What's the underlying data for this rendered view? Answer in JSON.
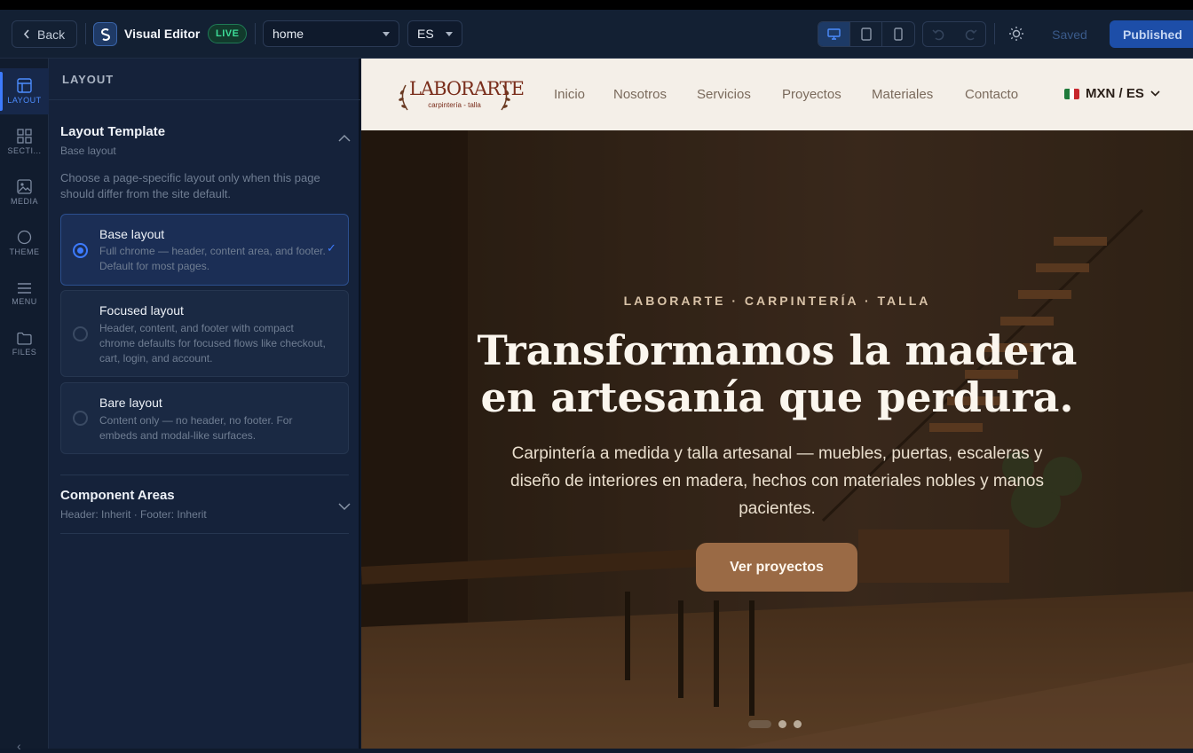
{
  "toolbar": {
    "back_label": "Back",
    "app_title": "Visual Editor",
    "status_badge": "LIVE",
    "page_select": "home",
    "lang_select": "ES",
    "saved_label": "Saved",
    "published_label": "Published",
    "devices": [
      "desktop-icon",
      "tablet-icon",
      "mobile-icon"
    ],
    "active_device": "desktop"
  },
  "rail": {
    "items": [
      {
        "label": "LAYOUT",
        "icon": "layout-icon",
        "active": true
      },
      {
        "label": "SECTI...",
        "icon": "sections-icon"
      },
      {
        "label": "MEDIA",
        "icon": "media-icon"
      },
      {
        "label": "THEME",
        "icon": "theme-icon"
      },
      {
        "label": "MENU",
        "icon": "menu-icon"
      },
      {
        "label": "FILES",
        "icon": "files-icon"
      }
    ]
  },
  "panel": {
    "heading": "LAYOUT",
    "layout_template": {
      "title": "Layout Template",
      "subtitle": "Base layout",
      "hint": "Choose a page-specific layout only when this page should differ from the site default.",
      "options": [
        {
          "title": "Base layout",
          "desc": "Full chrome — header, content area, and footer. Default for most pages.",
          "selected": true
        },
        {
          "title": "Focused layout",
          "desc": "Header, content, and footer with compact chrome defaults for focused flows like checkout, cart, login, and account."
        },
        {
          "title": "Bare layout",
          "desc": "Content only — no header, no footer. For embeds and modal-like surfaces."
        }
      ]
    },
    "component_areas": {
      "title": "Component Areas",
      "subtitle": "Header: Inherit · Footer: Inherit"
    }
  },
  "site": {
    "brand": {
      "name": "LABORARTE",
      "tagline": "carpintería - talla"
    },
    "nav": [
      "Inicio",
      "Nosotros",
      "Servicios",
      "Proyectos",
      "Materiales",
      "Contacto"
    ],
    "currency_lang": "MXN / ES",
    "hero": {
      "eyebrow": "LABORARTE · CARPINTERÍA · TALLA",
      "headline": "Transformamos la madera en artesanía que perdura.",
      "lede": "Carpintería a medida y talla artesanal — muebles, puertas, escaleras y diseño de interiores en madera, hechos con materiales nobles y manos pacientes.",
      "cta": "Ver proyectos",
      "slides": 3,
      "active_slide": 1
    }
  },
  "colors": {
    "accent": "#3d7bff",
    "live": "#3ddc97",
    "brand": "#7a2e1c",
    "cta": "#9a6a45"
  }
}
